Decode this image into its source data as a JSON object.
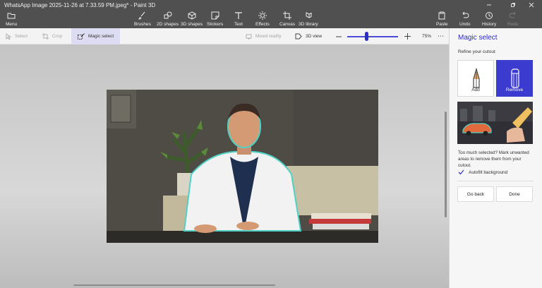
{
  "window": {
    "title": "WhatsApp Image 2025-11-26 at 7.33.59 PM.jpeg* - Paint 3D"
  },
  "ribbon": {
    "menu": {
      "label": "Menu",
      "icon": "folder-icon"
    },
    "tools": [
      {
        "label": "Brushes",
        "icon": "brush-icon"
      },
      {
        "label": "2D shapes",
        "icon": "2d-shapes-icon"
      },
      {
        "label": "3D shapes",
        "icon": "3d-shapes-icon"
      },
      {
        "label": "Stickers",
        "icon": "stickers-icon"
      },
      {
        "label": "Text",
        "icon": "text-icon"
      },
      {
        "label": "Effects",
        "icon": "effects-icon"
      },
      {
        "label": "Canvas",
        "icon": "canvas-icon"
      },
      {
        "label": "3D library",
        "icon": "3d-library-icon"
      }
    ],
    "paste": "Paste",
    "undo": "Undo",
    "history": "History",
    "redo": "Redo"
  },
  "toolbar": {
    "select": "Select",
    "crop": "Crop",
    "magic_select": "Magic select",
    "mixed_reality": "Mixed reality",
    "view_3d": "3D view",
    "zoom": "75%",
    "zoom_fraction": 0.36
  },
  "panel": {
    "title": "Magic select",
    "subtitle": "Refine your cutout",
    "add": "Add",
    "remove": "Remove",
    "hint": "Too much selected? Mark unwanted areas to remove them from your cutout.",
    "autofill": "Autofill background",
    "autofill_checked": true,
    "go_back": "Go back",
    "done": "Done"
  },
  "colors": {
    "accent": "#3b3bd0",
    "ribbon_bg": "#505050",
    "selection_outline": "#4fd1c5"
  }
}
